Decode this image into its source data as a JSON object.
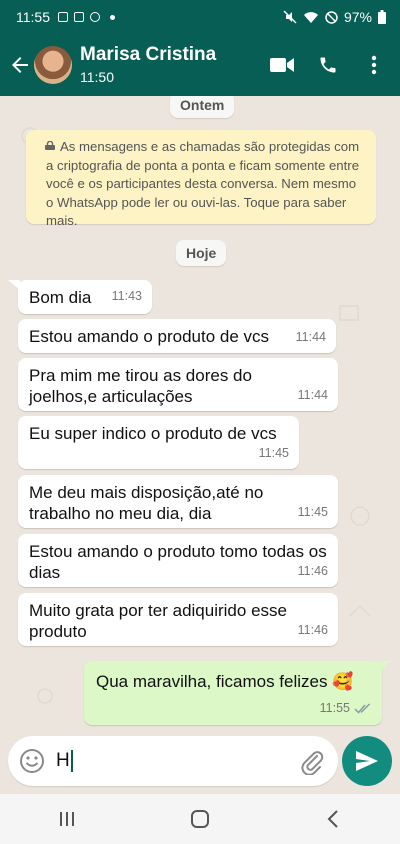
{
  "status_bar": {
    "time": "11:55",
    "battery": "97%"
  },
  "header": {
    "contact_name": "Marisa Cristina",
    "subtitle": "11:50"
  },
  "chat": {
    "day_yesterday": "Ontem",
    "encryption_notice": "As mensagens e as chamadas são protegidas com a criptografia de ponta a ponta e ficam somente entre você e os participantes desta conversa. Nem mesmo o WhatsApp pode ler ou ouvi-las. Toque para saber mais.",
    "day_today": "Hoje",
    "messages": [
      {
        "text": "Bom dia",
        "time": "11:43",
        "direction": "incoming"
      },
      {
        "text": "Estou amando o produto de vcs",
        "time": "11:44",
        "direction": "incoming"
      },
      {
        "text": "Pra mim me tirou as dores do joelhos,e articulações",
        "time": "11:44",
        "direction": "incoming"
      },
      {
        "text": "Eu super indico o produto de vcs",
        "time": "11:45",
        "direction": "incoming"
      },
      {
        "text": "Me deu mais disposição,até no trabalho no meu dia, dia",
        "time": "11:45",
        "direction": "incoming"
      },
      {
        "text": "Estou amando o produto tomo todas os dias",
        "time": "11:46",
        "direction": "incoming"
      },
      {
        "text": "Muito grata por ter adiquirido esse produto",
        "time": "11:46",
        "direction": "incoming"
      },
      {
        "text": "Qua maravilha, ficamos felizes 🥰",
        "time": "11:55",
        "direction": "outgoing",
        "read": true
      }
    ]
  },
  "composer": {
    "value": "H"
  },
  "colors": {
    "header": "#075E54",
    "send": "#128C7E",
    "outgoing_bubble": "#DCF8C6",
    "notice": "#FDF3C4",
    "wallpaper": "#ECE5DD"
  },
  "icons": [
    "arrow-back-icon",
    "video-call-icon",
    "phone-icon",
    "more-vert-icon",
    "lock-icon",
    "emoji-icon",
    "attach-icon",
    "send-icon",
    "double-check-icon",
    "recents-icon",
    "home-icon",
    "nav-back-icon"
  ]
}
